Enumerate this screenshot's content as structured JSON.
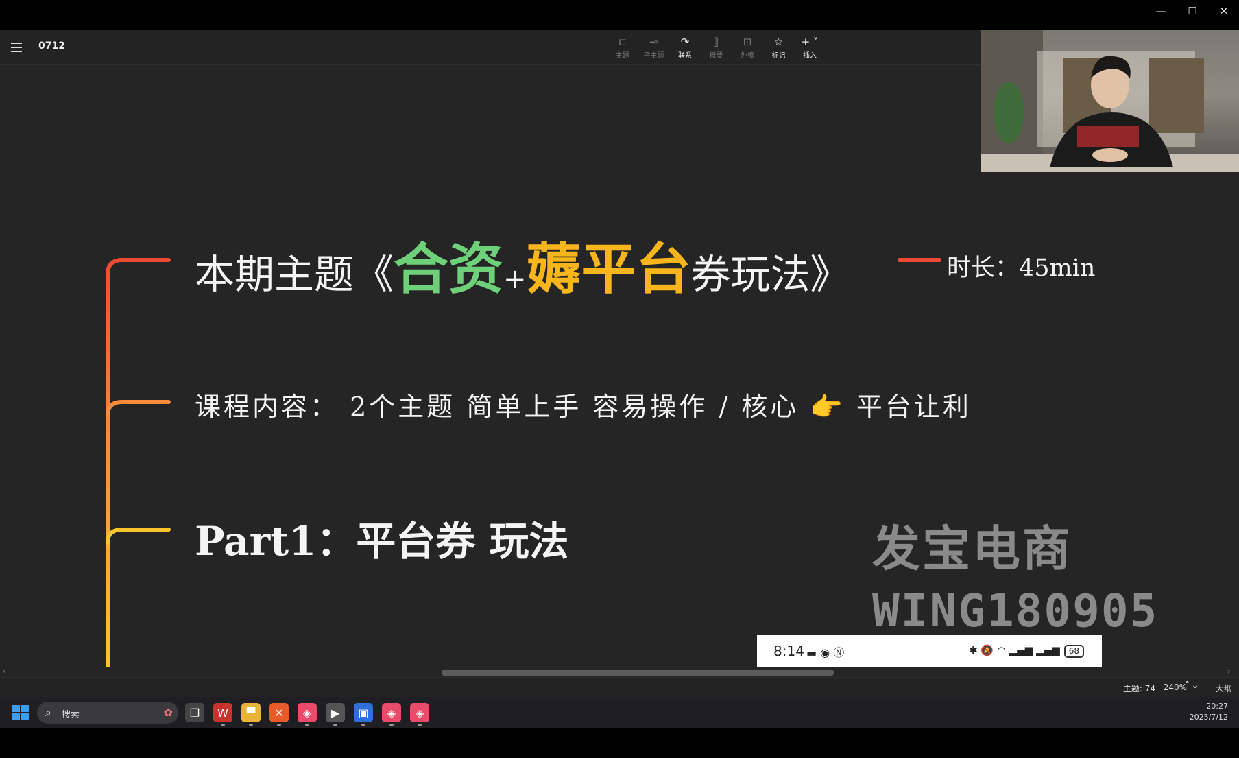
{
  "window": {
    "controls": {
      "minimize": "—",
      "maximize": "☐",
      "close": "✕"
    }
  },
  "app": {
    "doc_title": "0712",
    "toolbar": [
      {
        "label": "主题",
        "icon": "topic-icon",
        "glyph": "⊏",
        "active": false
      },
      {
        "label": "子主题",
        "icon": "subtopic-icon",
        "glyph": "⊸",
        "active": false
      },
      {
        "label": "联系",
        "icon": "relationship-icon",
        "glyph": "↷",
        "active": true
      },
      {
        "label": "概要",
        "icon": "summary-icon",
        "glyph": "⟧",
        "active": false
      },
      {
        "label": "外框",
        "icon": "boundary-icon",
        "glyph": "⊡",
        "active": false
      },
      {
        "label": "标记",
        "icon": "marker-star-icon",
        "glyph": "☆",
        "active": true
      },
      {
        "label": "插入",
        "icon": "insert-plus-icon",
        "glyph": "+ ˅",
        "active": true
      }
    ]
  },
  "mindmap": {
    "title_prefix": "本期主题《",
    "title_green": "合资",
    "title_plus": "+",
    "title_orange": "薅平台",
    "title_suffix": "券玩法》",
    "duration": "时长：45min",
    "content_line": "课程内容： 2个主题  简单上手 容易操作 / 核心 👉 平台让利",
    "part1": "Part1：平台券 玩法",
    "branch_colors": [
      "#f04a32",
      "#f98c3a",
      "#fbc42a"
    ]
  },
  "watermark": {
    "line1": "发宝电商",
    "line2": "WING180905"
  },
  "phone_overlay": {
    "time": "8:14",
    "left_icons": "▬ ◉ Ⓝ",
    "right_icons": "✱ 🔕 ◠ ▂▄▆ ▂▄▆",
    "battery": "68"
  },
  "statusbar": {
    "topic_count": "主题: 74",
    "zoom": "240%",
    "zoom_arrow": "⌃⌄",
    "outline": "大纲"
  },
  "taskbar": {
    "search_placeholder": "搜索",
    "search_icon": "⌕",
    "apps": [
      {
        "name": "task-view",
        "glyph": "❐",
        "color": "#444"
      },
      {
        "name": "wps",
        "glyph": "W",
        "color": "#c8342c"
      },
      {
        "name": "file-explorer",
        "glyph": "▀",
        "color": "#e8b33a"
      },
      {
        "name": "xmind",
        "glyph": "✕",
        "color": "#e85a2a"
      },
      {
        "name": "app-pink",
        "glyph": "◈",
        "color": "#e94b6a"
      },
      {
        "name": "media-player",
        "glyph": "▶",
        "color": "#555"
      },
      {
        "name": "screen-recorder",
        "glyph": "▣",
        "color": "#2f6fd8"
      },
      {
        "name": "app-pink-2",
        "glyph": "◈",
        "color": "#e94b6a"
      },
      {
        "name": "app-pink-3",
        "glyph": "◈",
        "color": "#e94b6a"
      }
    ],
    "time": "20:27",
    "date": "2025/7/12"
  }
}
